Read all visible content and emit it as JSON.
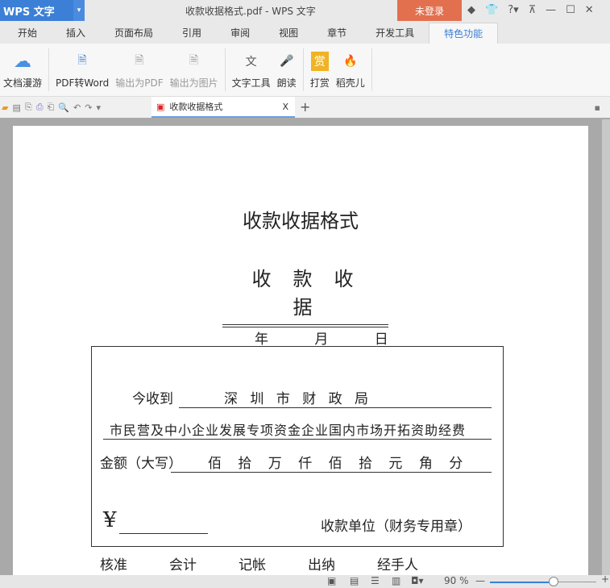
{
  "app": {
    "logo": "WPS 文字",
    "title": "收款收据格式.pdf - WPS 文字",
    "login": "未登录"
  },
  "tabs": [
    "开始",
    "插入",
    "页面布局",
    "引用",
    "审阅",
    "视图",
    "章节",
    "开发工具",
    "特色功能"
  ],
  "ribbon": [
    "文档漫游",
    "PDF转Word",
    "输出为PDF",
    "输出为图片",
    "文字工具",
    "朗读",
    "打赏",
    "稻壳儿"
  ],
  "doc_tab": {
    "title": "收款收据格式",
    "close": "X",
    "new": "+"
  },
  "document": {
    "title": "收款收据格式",
    "heading": "收款收据",
    "date": "年 月 日",
    "received_label": "今收到",
    "received_from": "深 圳 市 财 政 局",
    "purpose": "市民营及中小企业发展专项资金企业国内市场开拓资助经费",
    "amount_label": "金额（大写）",
    "amount_units": "佰 拾 万 仟 佰 拾 元 角 分",
    "currency": "¥",
    "payee": "收款单位（财务专用章）",
    "signatures": [
      "核准",
      "会计",
      "记帐",
      "出纳",
      "经手人"
    ]
  },
  "status": {
    "zoom": "90 %",
    "zoom_fraction": 0.6
  }
}
